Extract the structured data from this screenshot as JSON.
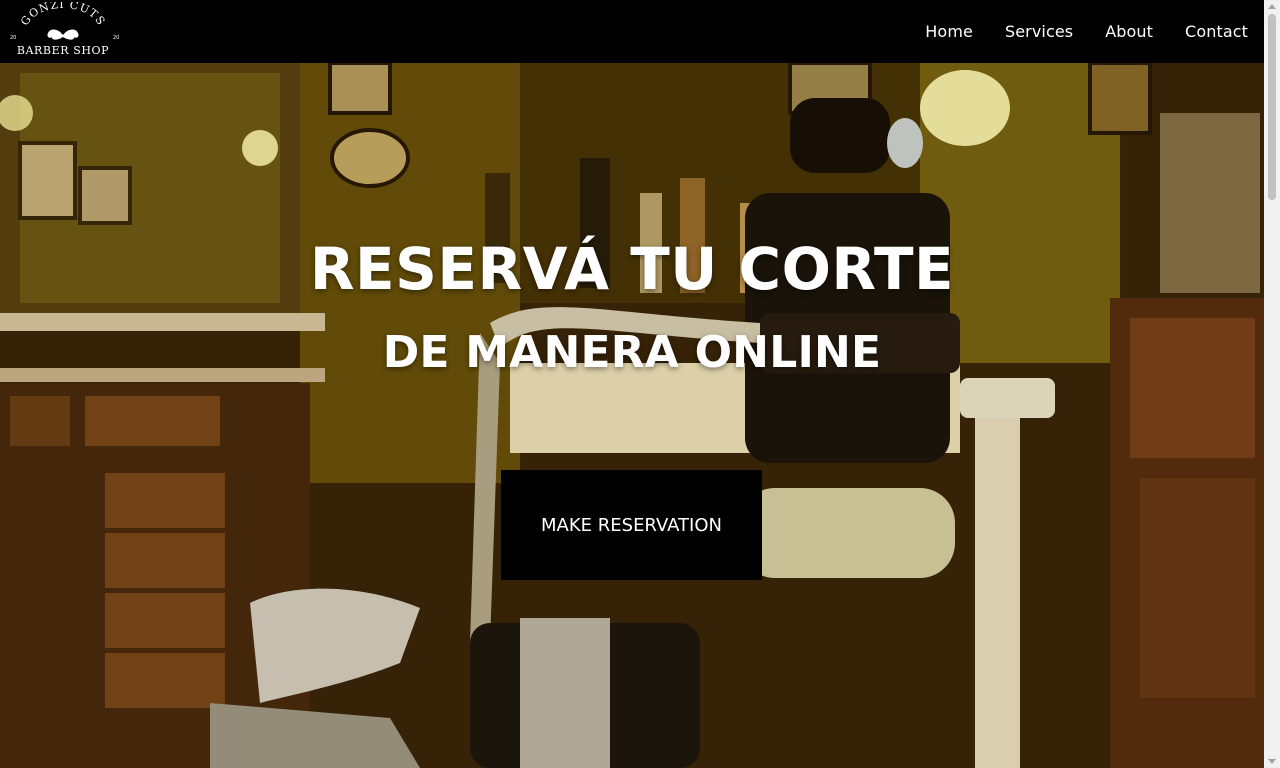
{
  "brand": {
    "name_top": "GONZI CUTS",
    "name_bottom": "BARBER SHOP",
    "year_left": "20",
    "year_right": "20"
  },
  "nav": {
    "items": [
      {
        "label": "Home"
      },
      {
        "label": "Services"
      },
      {
        "label": "About"
      },
      {
        "label": "Contact"
      }
    ]
  },
  "hero": {
    "headline_line1": "RESERVÁ TU CORTE",
    "headline_line2": "DE MANERA ONLINE",
    "cta_label": "MAKE RESERVATION",
    "background_image": "barbershop-interior-photo"
  },
  "colors": {
    "navbar_bg": "#000000",
    "text": "#ffffff",
    "cta_bg": "#000000"
  }
}
